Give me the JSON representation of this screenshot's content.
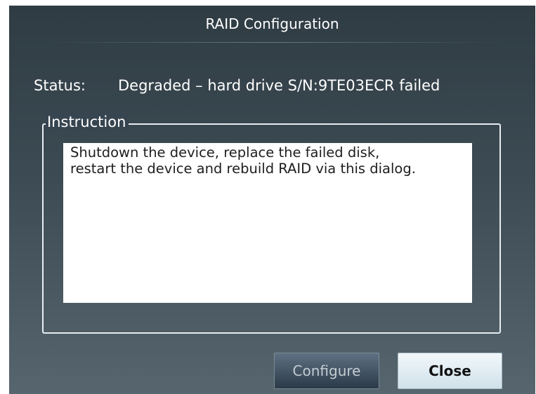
{
  "dialog": {
    "title": "RAID Configuration"
  },
  "status": {
    "label": "Status:",
    "value": "Degraded – hard drive S/N:9TE03ECR failed"
  },
  "instruction": {
    "legend": "Instruction",
    "line1": "Shutdown the device, replace the failed disk,",
    "line2": "restart the device and rebuild RAID via this dialog."
  },
  "buttons": {
    "configure_label": "Configure",
    "close_label": "Close"
  },
  "colors": {
    "dialog_background_top": "#2f3c44",
    "dialog_background_bottom": "#56656e",
    "text": "#ffffff",
    "configure_button": "#3b4b5a",
    "close_button": "#dceaf1"
  }
}
